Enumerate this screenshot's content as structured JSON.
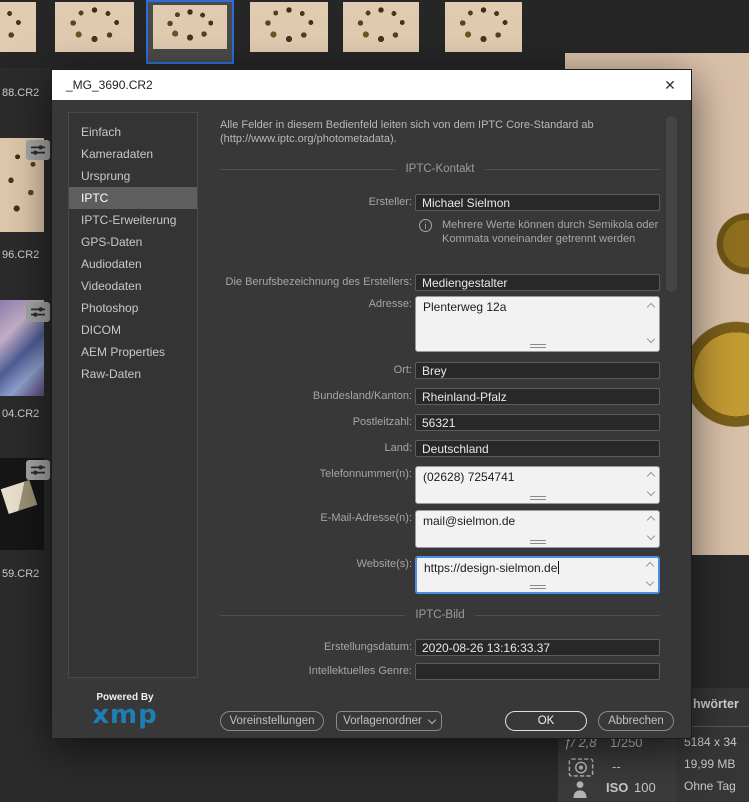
{
  "filmstrip": {
    "names": [
      "88.CR2",
      "96.CR2",
      "04.CR2",
      "59.CR2"
    ]
  },
  "dialog": {
    "title": "_MG_3690.CR2",
    "sidebar": {
      "items": [
        "Einfach",
        "Kameradaten",
        "Ursprung",
        "IPTC",
        "IPTC-Erweiterung",
        "GPS-Daten",
        "Audiodaten",
        "Videodaten",
        "Photoshop",
        "DICOM",
        "AEM Properties",
        "Raw-Daten"
      ],
      "selected": "IPTC"
    },
    "description": "Alle Felder in diesem Bedienfeld leiten sich von dem IPTC Core-Standard ab (http://www.iptc.org/photometadata).",
    "sections": {
      "kontakt": "IPTC-Kontakt",
      "bild": "IPTC-Bild"
    },
    "info_note": "Mehrere Werte können durch Semikola oder Kommata voneinander getrennt werden",
    "fields": {
      "ersteller": {
        "label": "Ersteller:",
        "value": "Michael Sielmon"
      },
      "beruf": {
        "label": "Die Berufsbezeichnung des Erstellers:",
        "value": "Mediengestalter"
      },
      "adresse": {
        "label": "Adresse:",
        "value": "Plenterweg 12a"
      },
      "ort": {
        "label": "Ort:",
        "value": "Brey"
      },
      "bundesland": {
        "label": "Bundesland/Kanton:",
        "value": "Rheinland-Pfalz"
      },
      "plz": {
        "label": "Postleitzahl:",
        "value": "56321"
      },
      "land": {
        "label": "Land:",
        "value": "Deutschland"
      },
      "telefon": {
        "label": "Telefonnummer(n):",
        "value": "(02628) 7254741"
      },
      "email": {
        "label": "E-Mail-Adresse(n):",
        "value": "mail@sielmon.de"
      },
      "website": {
        "label": "Website(s):",
        "value": "https://design-sielmon.de"
      },
      "datum": {
        "label": "Erstellungsdatum:",
        "value": "2020-08-26 13:16:33.37"
      },
      "genre": {
        "label": "Intellektuelles Genre:",
        "value": ""
      }
    },
    "footer": {
      "powered_by": "Powered By",
      "logo": "xmp",
      "preset_button": "Voreinstellungen",
      "template_button": "Vorlagenordner",
      "ok_button": "OK",
      "cancel_button": "Abbrechen"
    }
  },
  "panels": {
    "keywords_tab_partial": "hwörter",
    "placard": {
      "aperture": "ƒ/ 2,8",
      "shutter": "1/250",
      "metering_value": "--",
      "iso_label": "ISO",
      "iso_value": "100"
    },
    "fileinfo": {
      "dimensions": "5184 x 34",
      "size": "19,99 MB",
      "label": "Ohne Tag"
    }
  },
  "icons": {
    "close": "✕",
    "info": "i"
  },
  "colors": {
    "selection_blue": "#2b6fd6",
    "focus_blue": "#4a90e2",
    "xmp_blue": "#1e7fb5",
    "preview_beige": "#d9c0a9"
  }
}
